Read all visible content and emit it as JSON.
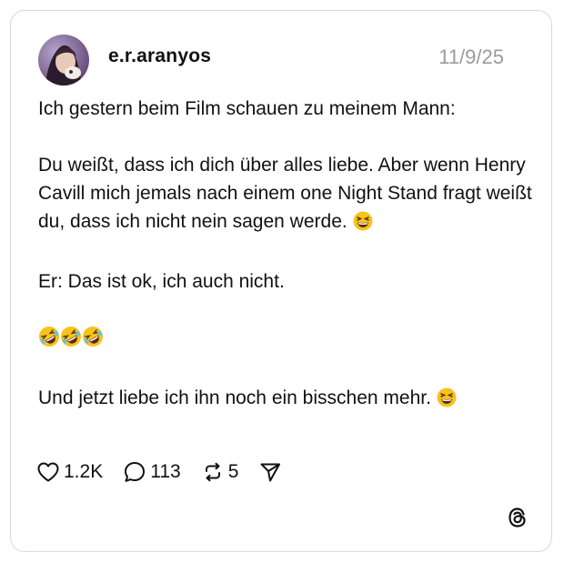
{
  "post": {
    "username": "e.r.aranyos",
    "date": "11/9/25",
    "lines": {
      "l1": "Ich gestern beim Film schauen zu meinem Mann:",
      "l2": "Du weißt, dass ich dich über alles liebe. Aber wenn Henry Cavill mich jemals nach einem one Night Stand fragt weißt du, dass ich nicht nein sagen werde.",
      "l3": "Er: Das ist ok, ich auch nicht.",
      "l4": "Und jetzt liebe ich ihn noch ein bisschen mehr."
    },
    "emojis": {
      "grin_squint": "grinning-squinting-face",
      "rofl": "rolling-on-the-floor-laughing",
      "rofl_count": 3
    }
  },
  "actions": {
    "likes": "1.2K",
    "comments": "113",
    "reposts": "5"
  },
  "icons": {
    "like": "heart-icon",
    "comment": "comment-bubble-icon",
    "repost": "repost-icon",
    "share": "send-icon",
    "brand": "threads-logo-icon"
  },
  "colors": {
    "text": "#111111",
    "muted": "#9a9a9a",
    "border": "#d9d9d9",
    "emoji": "#f7c21c"
  }
}
